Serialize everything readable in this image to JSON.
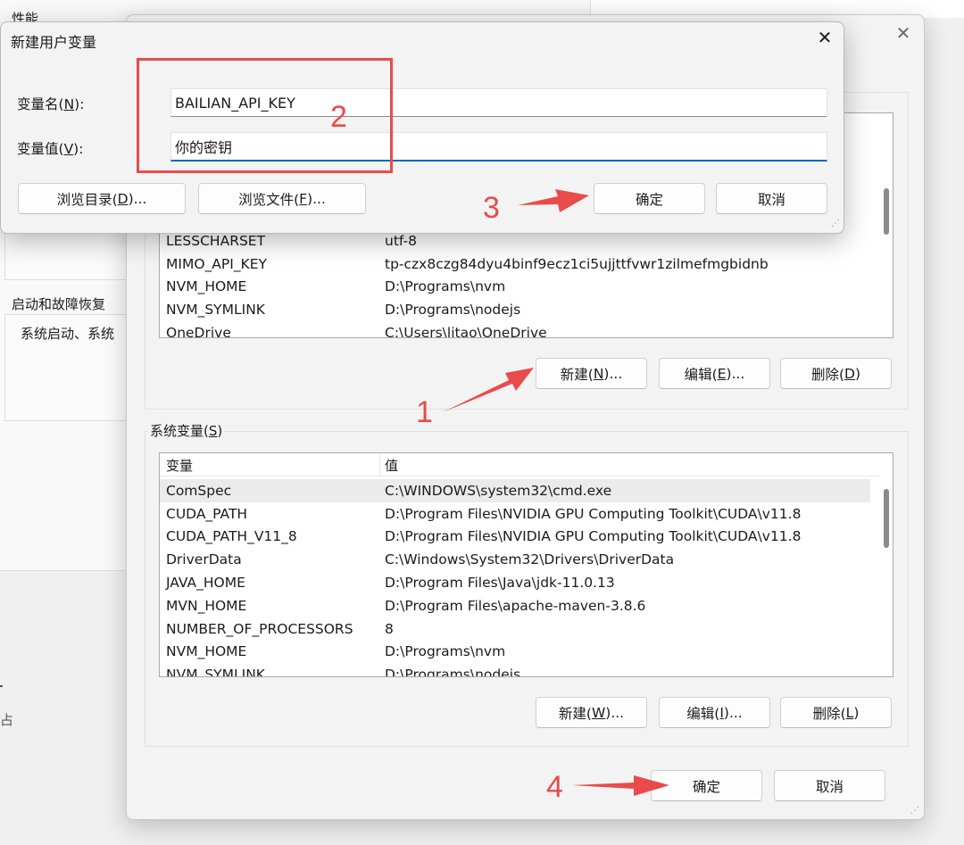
{
  "background": {
    "label_performance": "性能",
    "label_startup": "启动和故障恢复",
    "label_startup_desc": "系统启动、系统",
    "partial_char": "占"
  },
  "env_window": {
    "user_vars": {
      "rows": [
        {
          "name": "LESSCHARSET",
          "value": "utf-8"
        },
        {
          "name": "MIMO_API_KEY",
          "value": "tp-czx8czg84dyu4binf9ecz1ci5ujjttfvwr1zilmefmgbidnb"
        },
        {
          "name": "NVM_HOME",
          "value": "D:\\Programs\\nvm"
        },
        {
          "name": "NVM_SYMLINK",
          "value": "D:\\Programs\\nodejs"
        },
        {
          "name": "OneDrive",
          "value": "C:\\Users\\litao\\OneDrive"
        }
      ],
      "buttons": {
        "new_pre": "新建(",
        "new_key": "N",
        "new_post": ")...",
        "edit_pre": "编辑(",
        "edit_key": "E",
        "edit_post": ")...",
        "delete_pre": "删除(",
        "delete_key": "D",
        "delete_post": ")"
      }
    },
    "system_vars": {
      "title_pre": "系统变量(",
      "title_key": "S",
      "title_post": ")",
      "col_name": "变量",
      "col_value": "值",
      "rows": [
        {
          "name": "ComSpec",
          "value": "C:\\WINDOWS\\system32\\cmd.exe",
          "selected": true
        },
        {
          "name": "CUDA_PATH",
          "value": "D:\\Program Files\\NVIDIA GPU Computing Toolkit\\CUDA\\v11.8"
        },
        {
          "name": "CUDA_PATH_V11_8",
          "value": "D:\\Program Files\\NVIDIA GPU Computing Toolkit\\CUDA\\v11.8"
        },
        {
          "name": "DriverData",
          "value": "C:\\Windows\\System32\\Drivers\\DriverData"
        },
        {
          "name": "JAVA_HOME",
          "value": "D:\\Program Files\\Java\\jdk-11.0.13"
        },
        {
          "name": "MVN_HOME",
          "value": "D:\\Program Files\\apache-maven-3.8.6"
        },
        {
          "name": "NUMBER_OF_PROCESSORS",
          "value": "8"
        },
        {
          "name": "NVM_HOME",
          "value": "D:\\Programs\\nvm"
        },
        {
          "name": "NVM_SYMLINK",
          "value": "D:\\Programs\\nodejs"
        }
      ],
      "buttons": {
        "new_pre": "新建(",
        "new_key": "W",
        "new_post": ")...",
        "edit_pre": "编辑(",
        "edit_key": "I",
        "edit_post": ")...",
        "delete_pre": "删除(",
        "delete_key": "L",
        "delete_post": ")"
      }
    },
    "ok_label": "确定",
    "cancel_label": "取消"
  },
  "dialog": {
    "title": "新建用户变量",
    "name_label_pre": "变量名(",
    "name_label_key": "N",
    "name_label_post": "):",
    "name_value": "BAILIAN_API_KEY",
    "value_label_pre": "变量值(",
    "value_label_key": "V",
    "value_label_post": "):",
    "value_value": "你的密钥",
    "browse_dir_pre": "浏览目录(",
    "browse_dir_key": "D",
    "browse_dir_post": ")...",
    "browse_file_pre": "浏览文件(",
    "browse_file_key": "F",
    "browse_file_post": ")...",
    "ok_label": "确定",
    "cancel_label": "取消"
  },
  "annotations": {
    "step1": "1",
    "step2": "2",
    "step3": "3",
    "step4": "4",
    "color": "#e94b4b"
  }
}
